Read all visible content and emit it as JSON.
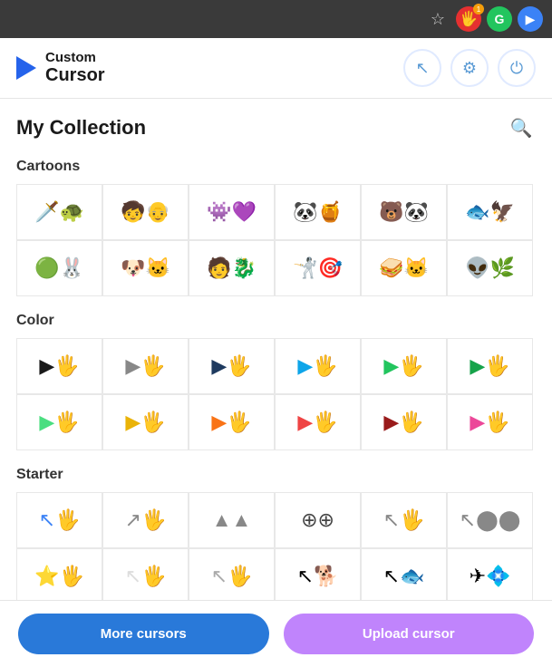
{
  "browser": {
    "star_label": "☆",
    "ext1_label": "🖐",
    "ext1_badge": "1",
    "ext2_label": "G",
    "ext3_label": "▶"
  },
  "header": {
    "logo_custom": "Custom",
    "logo_cursor": "Cursor",
    "btn_cursor_label": "↖",
    "btn_settings_label": "⚙",
    "btn_power_label": "⏻"
  },
  "page": {
    "title": "My Collection",
    "search_label": "🔍"
  },
  "categories": [
    {
      "id": "cartoons",
      "title": "Cartoons",
      "rows": [
        [
          "🗡🐢",
          "🧒👴",
          "👾💜",
          "🐼🍯",
          "🐻🐼",
          "🐟🦅"
        ],
        [
          "🟢🐰",
          "🐶🐱",
          "👤🐉",
          "🤺👤",
          "🥪🐱",
          "👽🌿"
        ]
      ]
    },
    {
      "id": "color",
      "title": "Color",
      "rows": [
        [
          "▶🖐black",
          "▶🖐gray",
          "▶🖐navy",
          "▶🖐teal",
          "▶🖐green",
          "▶🖐green2"
        ],
        [
          "▶🖐lgreen",
          "▶🖐yellow",
          "▶🖐orange",
          "▶🖐red",
          "▶🖐darkred",
          "▶🖐pink"
        ]
      ]
    },
    {
      "id": "starter",
      "title": "Starter",
      "rows": [
        [
          "↖🖐blue",
          "↗🖐outline",
          "▲▲gray",
          "⊕⊕",
          "↖🖐outline2",
          "↖🖐dots"
        ],
        [
          "⭐🖐yellow",
          "↖🖐light",
          "↖🖐white",
          "↖🐕",
          "↖🐟",
          "✈💠"
        ]
      ]
    }
  ],
  "buttons": {
    "more_cursors": "More cursors",
    "upload_cursor": "Upload cursor"
  }
}
